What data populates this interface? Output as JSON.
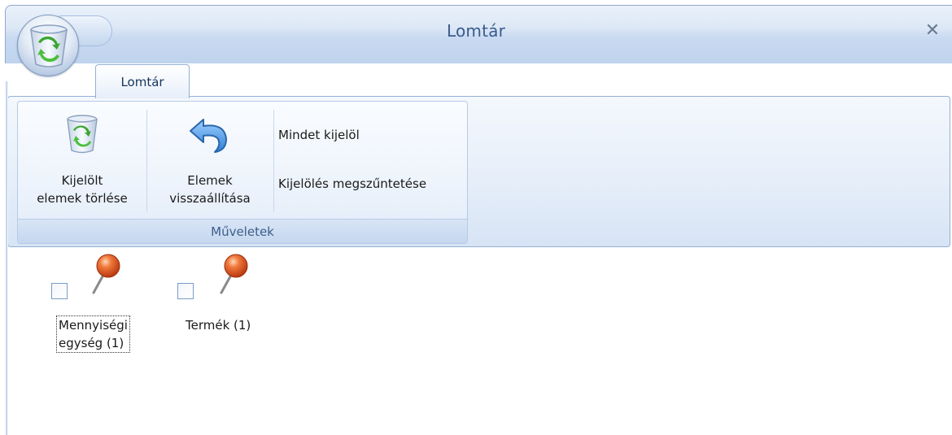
{
  "window": {
    "title": "Lomtár",
    "close_glyph": "✕"
  },
  "app_button": {
    "icon": "recycle-bin-icon"
  },
  "ribbon": {
    "tabs": [
      {
        "label": "Lomtár",
        "active": true
      }
    ],
    "groups": [
      {
        "label": "Műveletek",
        "buttons": [
          {
            "label_line1": "Kijelölt",
            "label_line2": "elemek törlése",
            "icon": "recycle-bin-icon"
          },
          {
            "label_line1": "Elemek",
            "label_line2": "visszaállítása",
            "icon": "undo-arrow-icon"
          }
        ],
        "small_buttons": [
          {
            "label": "Mindet kijelöl"
          },
          {
            "label": "Kijelölés megszűntetése"
          }
        ]
      }
    ]
  },
  "items": [
    {
      "label_line1": "Mennyiségi",
      "label_line2": "egység (1)",
      "checked": false,
      "focused": true,
      "icon": "pushpin-icon"
    },
    {
      "label_line1": "Termék (1)",
      "label_line2": "",
      "checked": false,
      "focused": false,
      "icon": "pushpin-icon"
    }
  ],
  "colors": {
    "accent": "#3a5b8c",
    "pin_head": "#e2531f",
    "recycle_green": "#3aa62f"
  }
}
